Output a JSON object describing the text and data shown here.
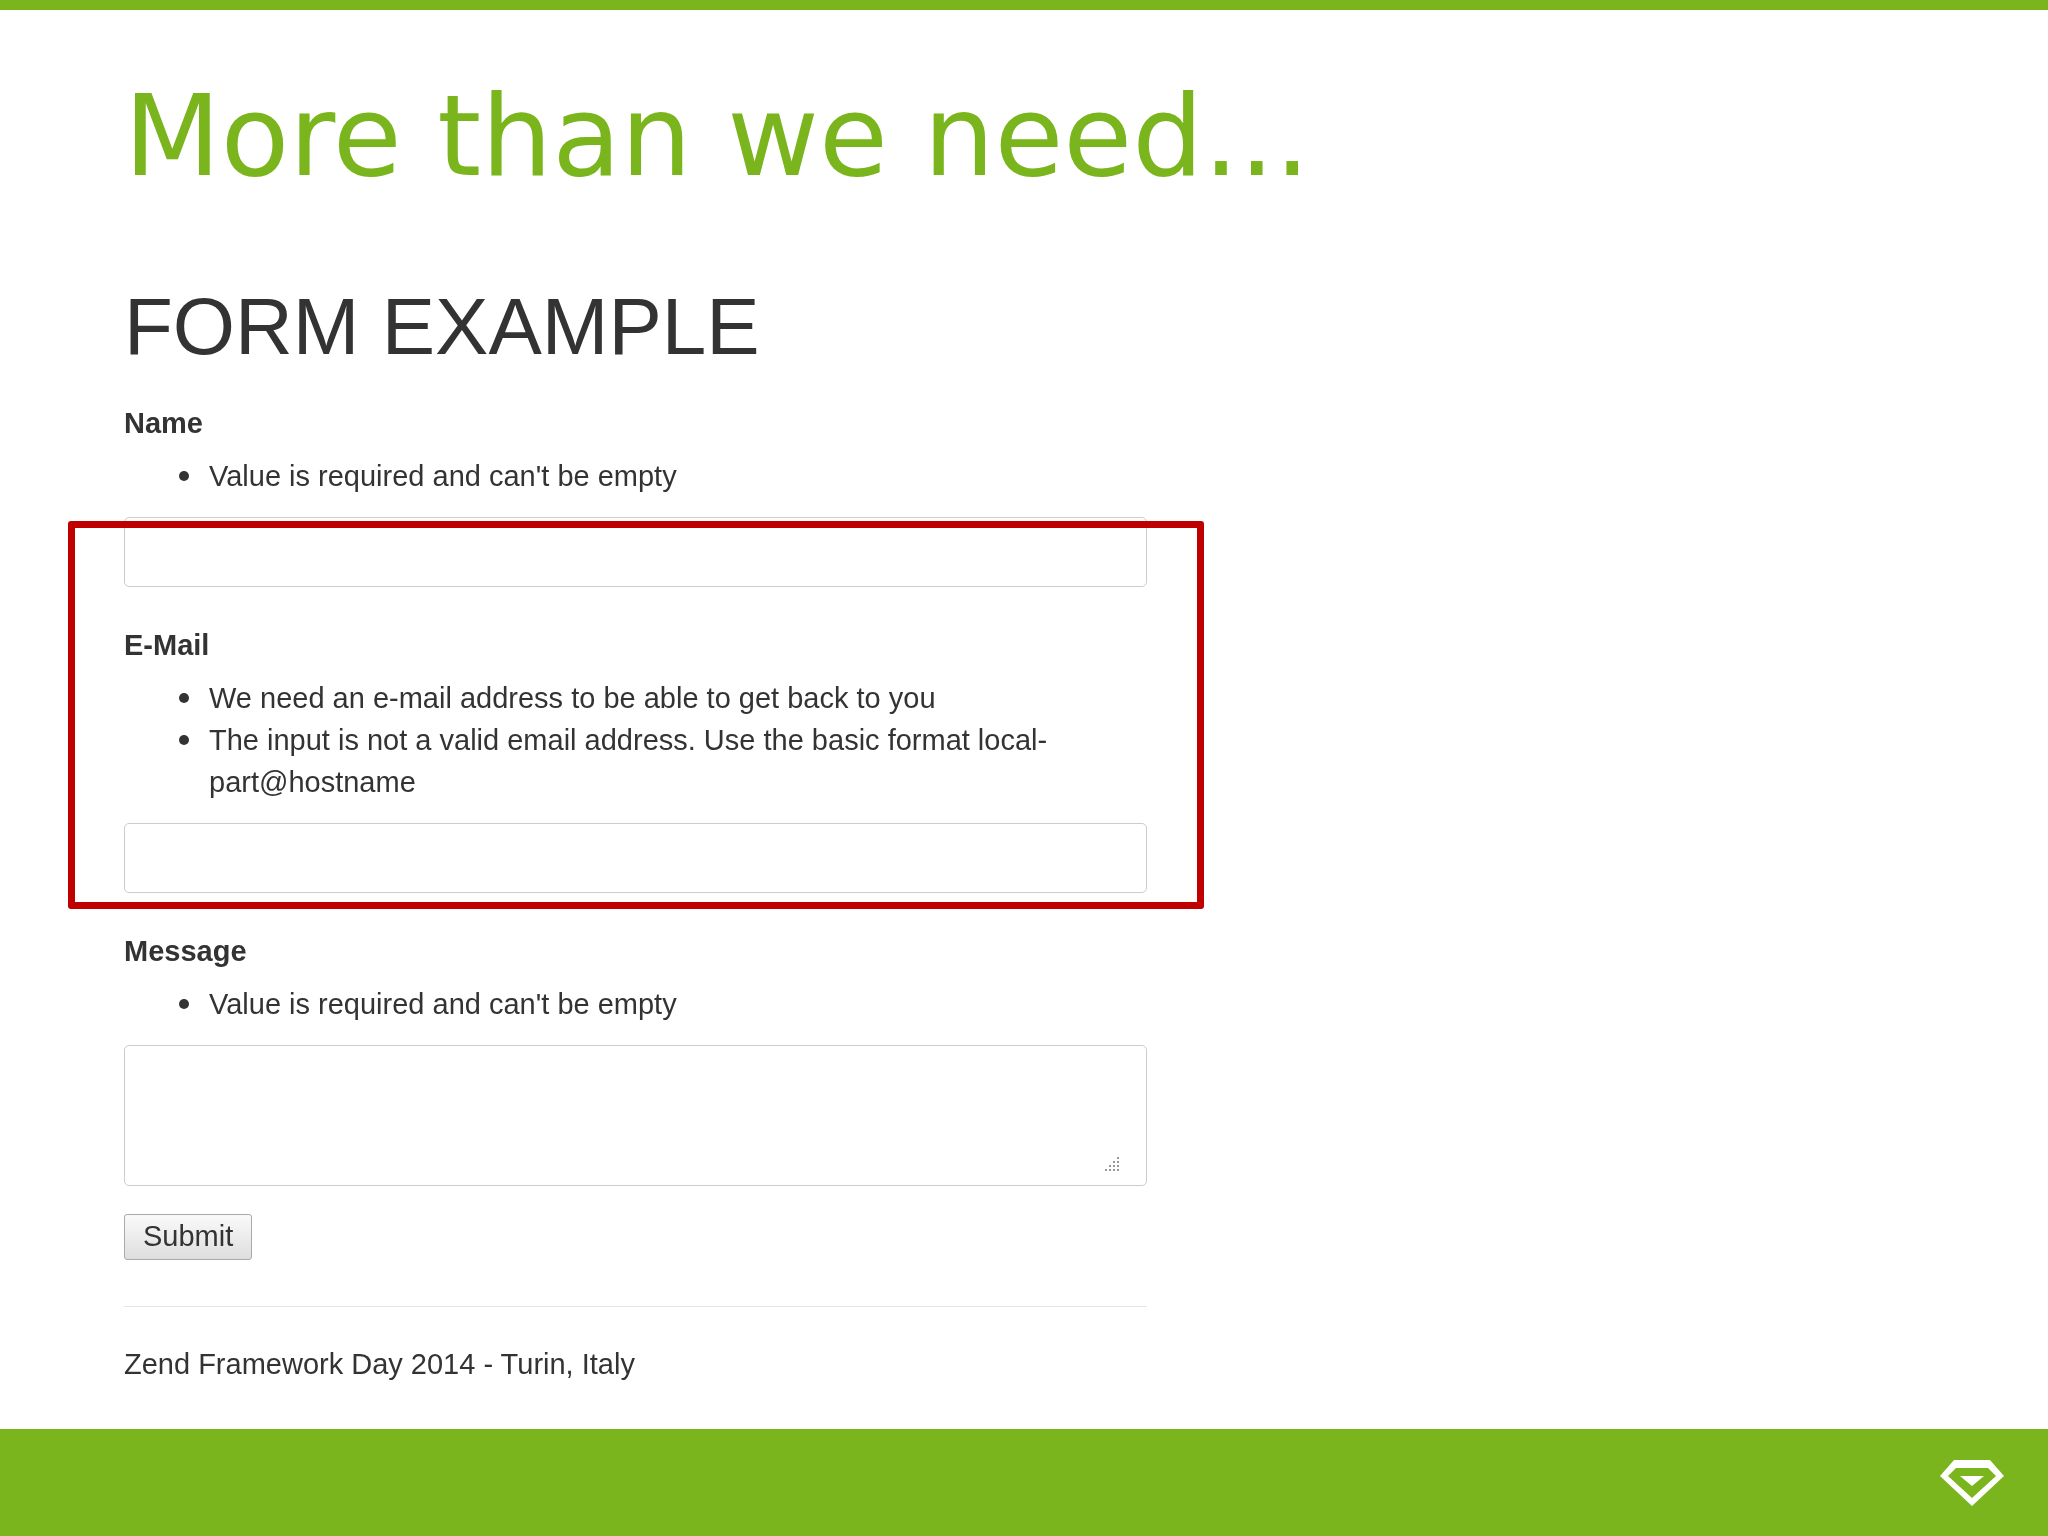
{
  "slide": {
    "title": "More than we need..."
  },
  "form": {
    "heading": "FORM EXAMPLE",
    "fields": [
      {
        "label": "Name",
        "kind": "input",
        "errors": [
          "Value is required and can't be empty"
        ]
      },
      {
        "label": "E-Mail",
        "kind": "input",
        "highlighted": true,
        "errors": [
          "We need an e-mail address to be able to get back to you",
          "The input is not a valid email address. Use the basic format local-part@hostname"
        ]
      },
      {
        "label": "Message",
        "kind": "textarea",
        "errors": [
          "Value is required and can't be empty"
        ]
      }
    ],
    "submit": "Submit",
    "footer": "Zend Framework Day 2014 - Turin, Italy"
  }
}
